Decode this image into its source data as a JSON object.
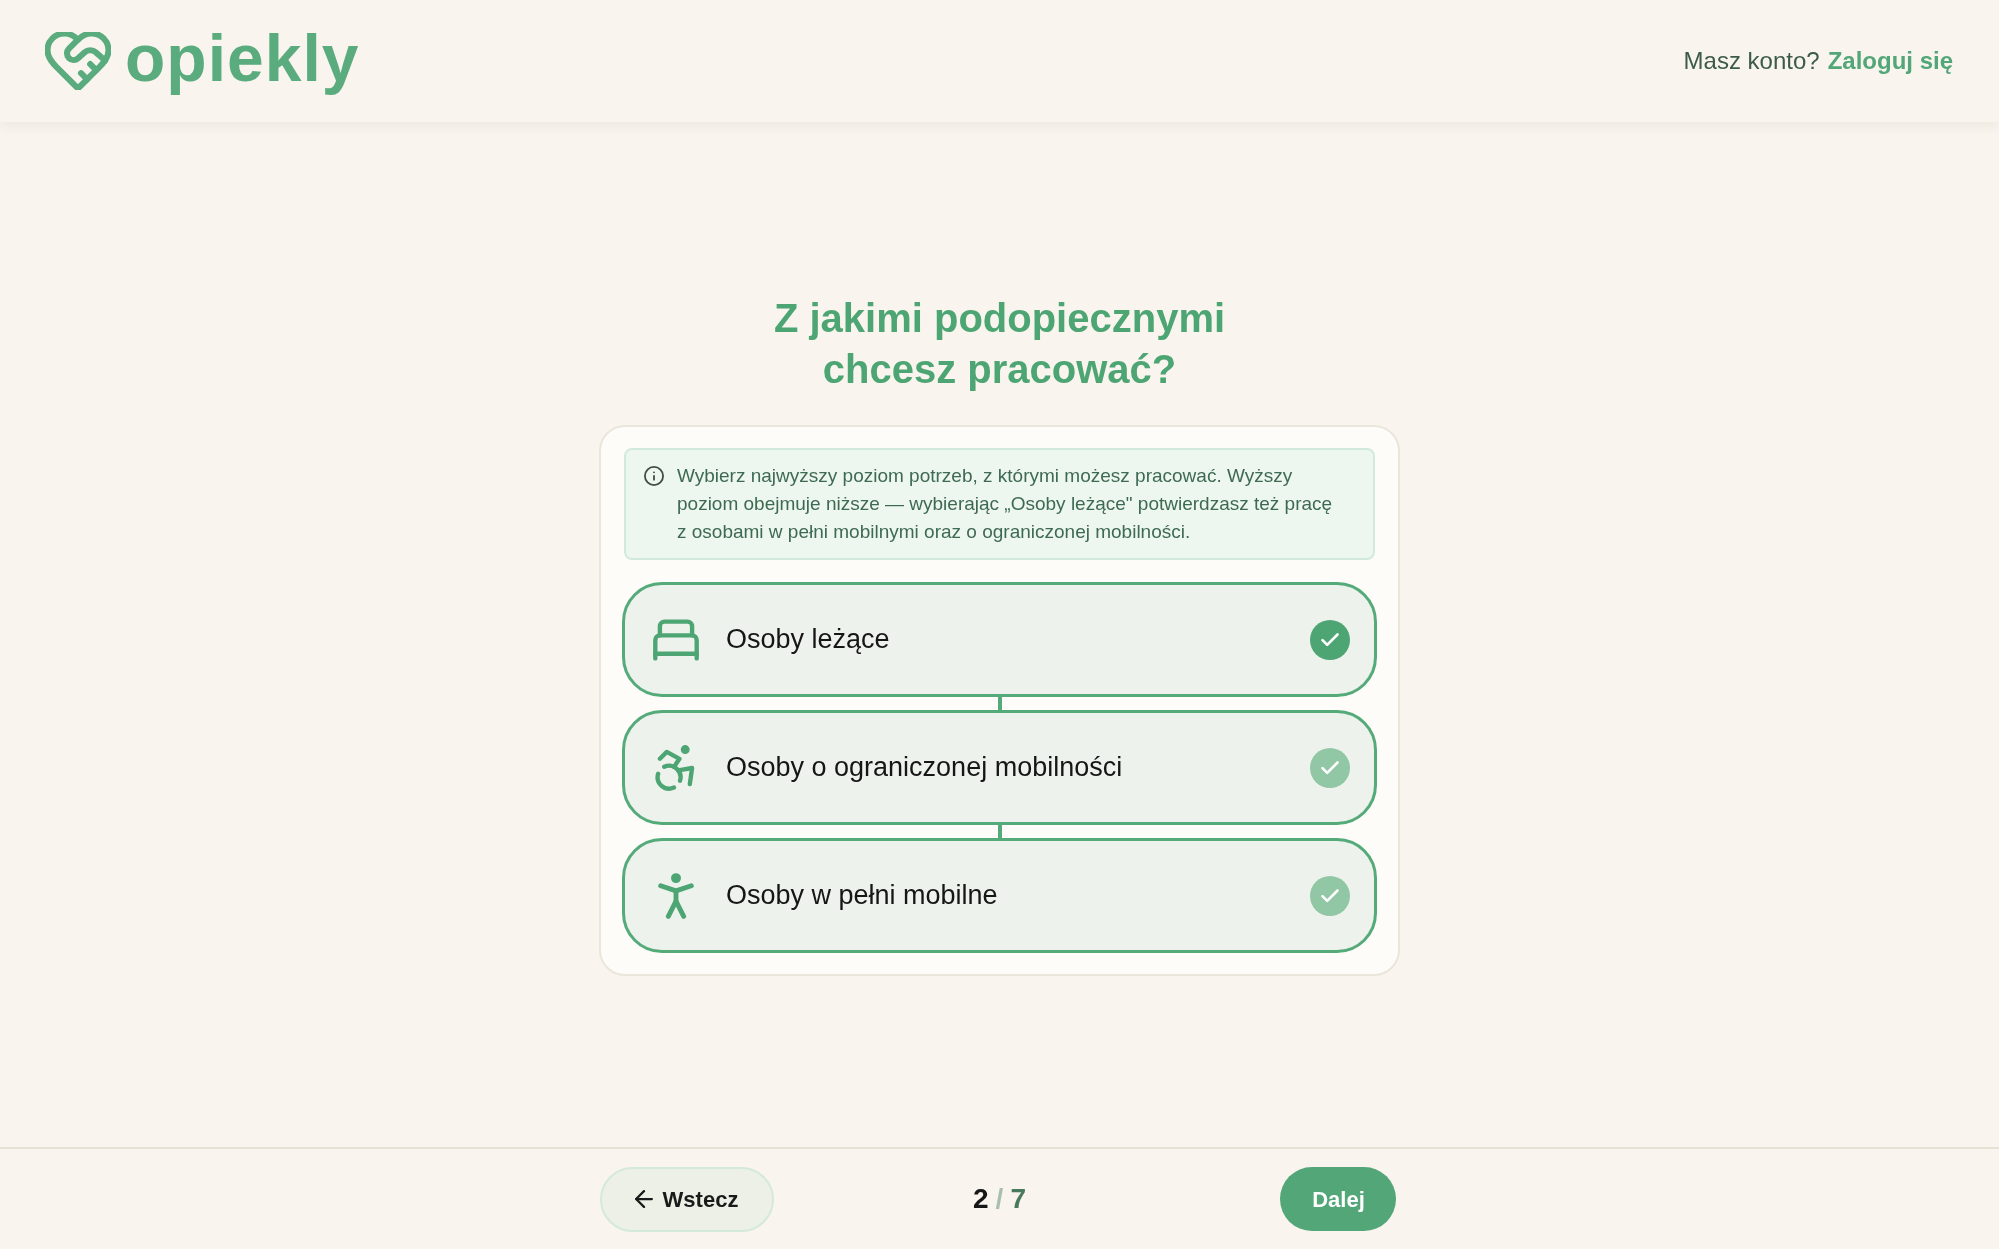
{
  "header": {
    "logo": "opiekly",
    "login_prompt": "Masz konto?",
    "login_link": "Zaloguj się"
  },
  "title": "Z jakimi podopiecznymi chcesz pracować?",
  "info": "Wybierz najwyższy poziom potrzeb, z którymi możesz pracować. Wyższy poziom obejmuje niższe — wybierając „Osoby leżące\" potwierdzasz też pracę z osobami w pełni mobilnymi oraz o ograniczonej mobilności.",
  "options": [
    {
      "kind": "bedridden",
      "label": "Osoby leżące",
      "selected": true,
      "checked": true
    },
    {
      "kind": "limited",
      "label": "Osoby o ograniczonej mobilności",
      "selected": false,
      "checked": true
    },
    {
      "kind": "mobile",
      "label": "Osoby w pełni mobilne",
      "selected": false,
      "checked": true
    }
  ],
  "footer": {
    "back_button": "Wstecz",
    "step": {
      "current": "2",
      "separator": "/",
      "total": "7"
    },
    "next_button": "Dalej"
  }
}
